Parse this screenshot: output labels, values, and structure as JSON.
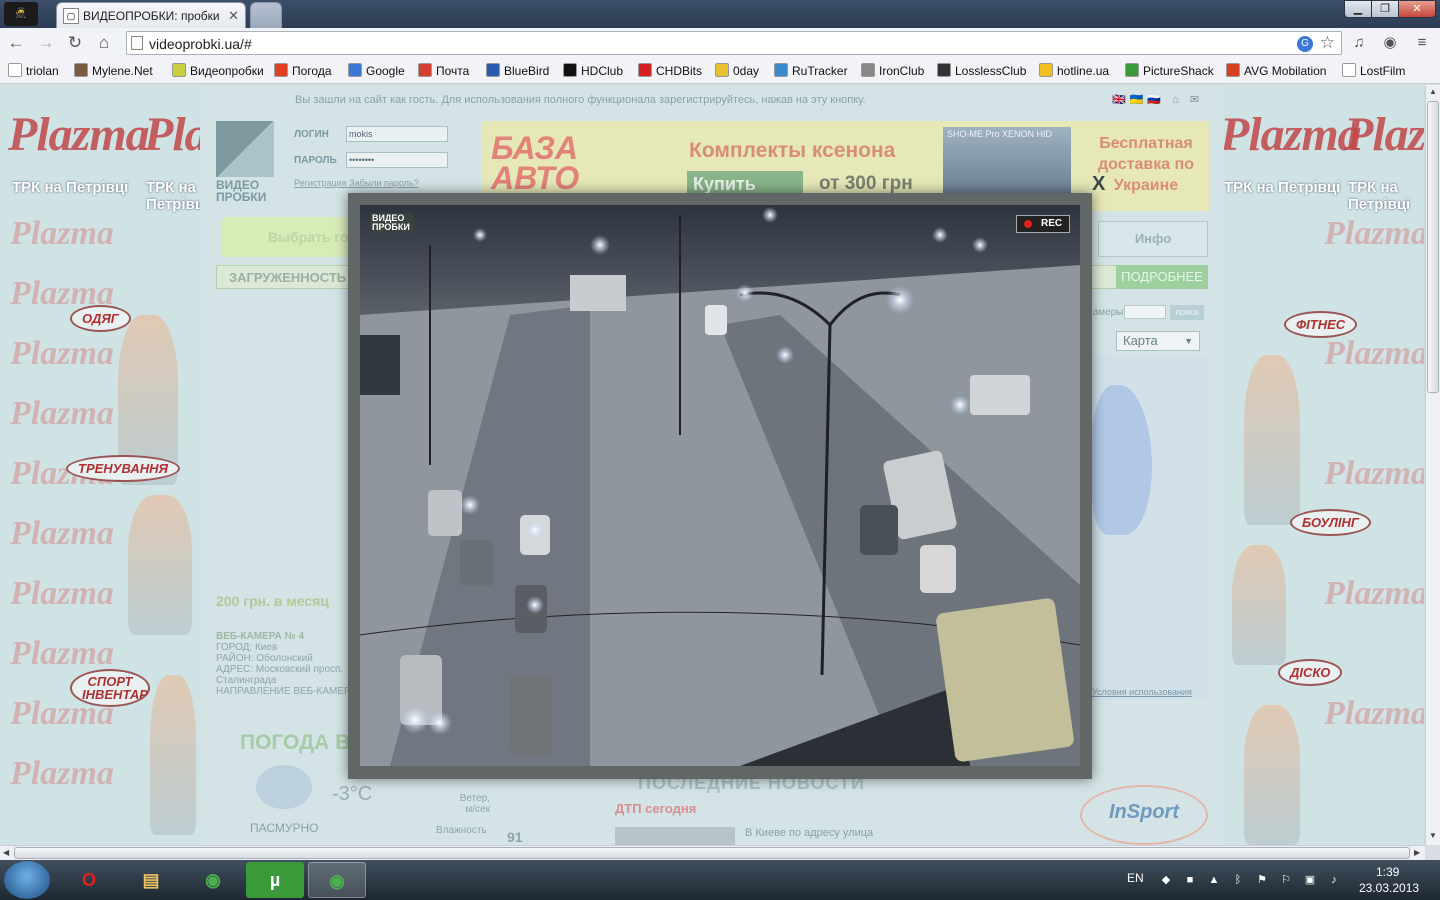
{
  "browser": {
    "tab_title": "ВИДЕОПРОБКИ: пробки",
    "tab_close": "✕",
    "url": "videoprobki.ua/#",
    "bookmarks": [
      {
        "label": "triolan",
        "color": "#ffffff"
      },
      {
        "label": "Mylene.Net",
        "color": "#7a5a40"
      },
      {
        "label": "Видеопробки",
        "color": "#c8d040"
      },
      {
        "label": "Погода",
        "color": "#e04020"
      },
      {
        "label": "Google",
        "color": "#3a78d8"
      },
      {
        "label": "Почта",
        "color": "#d44030"
      },
      {
        "label": "BlueBird",
        "color": "#2a5ab0"
      },
      {
        "label": "HDClub",
        "color": "#111111"
      },
      {
        "label": "CHDBits",
        "color": "#d02020"
      },
      {
        "label": "0day",
        "color": "#e8c030"
      },
      {
        "label": "RuTracker",
        "color": "#3a8ad0"
      },
      {
        "label": "IronClub",
        "color": "#888888"
      },
      {
        "label": "LosslessClub",
        "color": "#333333"
      },
      {
        "label": "hotline.ua",
        "color": "#f0c020"
      },
      {
        "label": "PictureShack",
        "color": "#3a9a3a"
      },
      {
        "label": "AVG Mobilation",
        "color": "#d84020"
      },
      {
        "label": "LostFilm",
        "color": "#ffffff"
      }
    ]
  },
  "site": {
    "guest_note": "Вы зашли на сайт как гость. Для использования полного функционала зарегистрируйтесь, нажав на эту кнопку.",
    "logo_text": "ВИДЕО ПРОБКИ",
    "login_label": "ЛОГИН",
    "login_value": "mokis",
    "password_label": "ПАРОЛЬ",
    "password_value": "••••••••",
    "register_link": "Регистрация",
    "forgot_link": "Забыли пароль?",
    "banner": {
      "logo": "БАЗА АВТО ЗВУКА",
      "title": "Комплекты ксенона",
      "buy": "Купить",
      "price": "от 300 грн",
      "lamp_text": "SHO-ME Pro XENON HID",
      "free_delivery": "Бесплатная доставка по Украине"
    },
    "tab_choose": "Выбрать город",
    "tab_info": "Инфо",
    "load_label": "ЗАГРУЖЕННОСТЬ",
    "more_button": "ПОДРОБНЕЕ",
    "cam_search_label": "камеры",
    "cam_search_button": "поиск",
    "map_select": "Карта",
    "map_terms": "Условия использования",
    "price_line": "200 грн. в месяц",
    "cam_info_title": "ВЕБ-КАМЕРА № 4",
    "cam_info_lines": [
      "ГОРОД: Киев",
      "РАЙОН: Оболонский",
      "АДРЕС: Московский просп.",
      "Сталинграда",
      "НАПРАВЛЕНИЕ ВЕБ-КАМЕРЫ"
    ],
    "weather_title": "ПОГОДА В",
    "weather_temp": "-3°C",
    "weather_desc": "ПАСМУРНО",
    "wind_label": "Ветер, м/сек",
    "humidity_label": "Влажность",
    "humidity_value": "91",
    "news_title": "ПОСЛЕДНИЕ НОВОСТИ",
    "dtp_title": "ДТП сегодня",
    "news_item": "В Киеве по адресу улица",
    "insport": "InSport"
  },
  "ads": {
    "brand": "Plazma",
    "trk": "ТРК на Петрівці",
    "left_bubbles": [
      "ОДЯГ",
      "ТРЕНУВАННЯ",
      "СПОРТ ІНВЕНТАР"
    ],
    "right_bubbles": [
      "ФІТНЕС",
      "БОУЛІНГ",
      "ДІСКО"
    ]
  },
  "modal": {
    "close": "X",
    "cam_logo": "ВИДЕО ПРОБКИ",
    "rec": "REC"
  },
  "taskbar": {
    "lang": "EN",
    "time": "1:39",
    "date": "23.03.2013",
    "apps": [
      "Opera",
      "Explorer",
      "Chrome",
      "uTorrent",
      "Chrome"
    ]
  }
}
